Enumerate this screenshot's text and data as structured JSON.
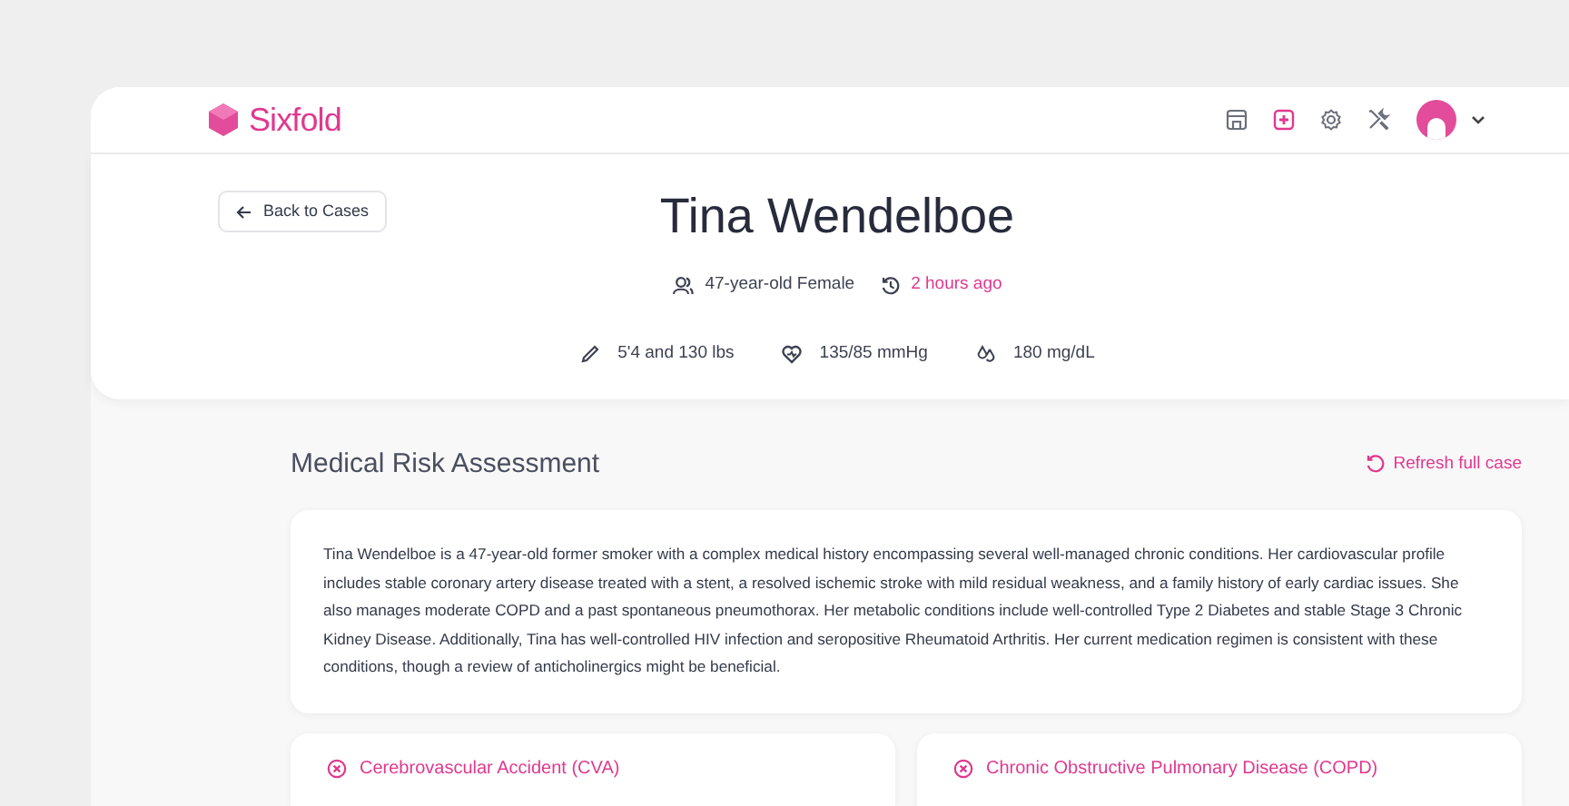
{
  "header": {
    "logo": "Sixfold",
    "nav": [
      {
        "kind": "building",
        "selected": false
      },
      {
        "kind": "medical",
        "selected": true
      },
      {
        "kind": "settings",
        "selected": false
      },
      {
        "kind": "tools",
        "selected": false
      }
    ]
  },
  "hero": {
    "back": "Back to Cases",
    "name": "Tina Wendelboe",
    "demographic": "47-year-old Female",
    "updated": "2 hours ago",
    "vitals": [
      {
        "kind": "ruler",
        "text": "5'4 and 130 lbs"
      },
      {
        "kind": "heart",
        "text": "135/85 mmHg"
      },
      {
        "kind": "drops",
        "text": "180 mg/dL"
      }
    ]
  },
  "assessment": {
    "title": "Medical Risk Assessment",
    "refresh": "Refresh full case",
    "summary": "Tina Wendelboe is a 47-year-old former smoker with a complex medical history encompassing several well-managed chronic conditions. Her cardiovascular profile includes stable coronary artery disease treated with a stent, a resolved ischemic stroke with mild residual weakness, and a family history of early cardiac issues. She also manages moderate COPD and a past spontaneous pneumothorax. Her metabolic conditions include well-controlled Type 2 Diabetes and stable Stage 3 Chronic Kidney Disease. Additionally, Tina has well-controlled HIV infection and seropositive Rheumatoid Arthritis. Her current medication regimen is consistent with these conditions, though a review of anticholinergics might be beneficial.",
    "conditions": [
      "Cerebrovascular Accident (CVA)",
      "Chronic Obstructive Pulmonary Disease (COPD)"
    ]
  }
}
